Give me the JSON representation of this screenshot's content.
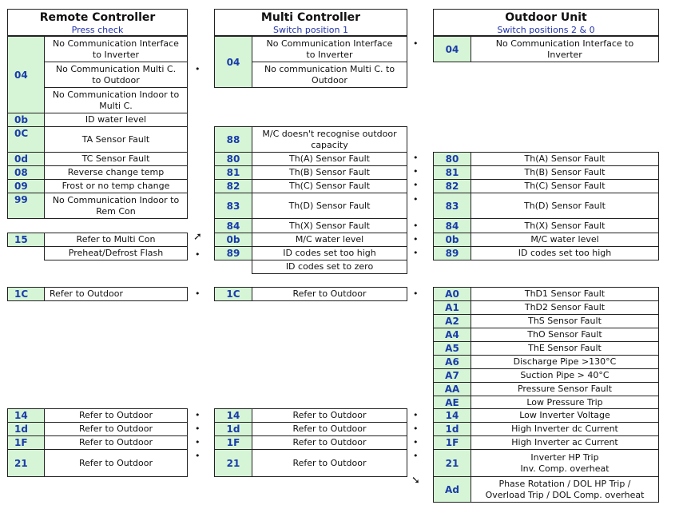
{
  "marks": {
    "bullet": "•",
    "arrow_up_right": "➚",
    "arrow_down_right": "➘"
  },
  "colors": {
    "code_bg": "#d6f5d6",
    "code_text": "#1a3caa",
    "subtitle": "#2233aa"
  },
  "left": {
    "title": "Remote Controller",
    "subtitle": "Press check",
    "rows": [
      {
        "code": "04",
        "desc": "No Communication Interface\nto Inverter"
      },
      {
        "code": "",
        "desc": "No Communication Multi C.\nto Outdoor"
      },
      {
        "code": "",
        "desc": "No Communication Indoor to\nMulti C."
      },
      {
        "code": "0b",
        "desc": "ID water level"
      },
      {
        "code": "0C",
        "desc": "TA Sensor Fault"
      },
      {
        "code": "0d",
        "desc": "TC Sensor Fault"
      },
      {
        "code": "08",
        "desc": "Reverse change temp"
      },
      {
        "code": "09",
        "desc": "Frost or no temp change"
      },
      {
        "code": "99",
        "desc": "No Communication Indoor to\nRem Con"
      },
      {
        "code": "15",
        "desc": "Refer to Multi Con"
      },
      {
        "code": "",
        "desc": "Preheat/Defrost Flash"
      },
      {
        "code": "1C",
        "desc": "Refer to Outdoor"
      },
      {
        "code": "14",
        "desc": "Refer to Outdoor"
      },
      {
        "code": "1d",
        "desc": "Refer to Outdoor"
      },
      {
        "code": "1F",
        "desc": "Refer to Outdoor"
      },
      {
        "code": "21",
        "desc": "Refer to Outdoor"
      }
    ]
  },
  "middle": {
    "title": "Multi Controller",
    "subtitle": "Switch position 1",
    "rows": [
      {
        "code": "04",
        "desc": "No Communication Interface\nto Inverter"
      },
      {
        "code": "",
        "desc": "No communication Multi C. to\nOutdoor"
      },
      {
        "code": "88",
        "desc": "M/C doesn't recognise outdoor\ncapacity"
      },
      {
        "code": "80",
        "desc": "Th(A) Sensor Fault"
      },
      {
        "code": "81",
        "desc": "Th(B) Sensor Fault"
      },
      {
        "code": "82",
        "desc": "Th(C) Sensor Fault"
      },
      {
        "code": "83",
        "desc": "Th(D) Sensor Fault"
      },
      {
        "code": "84",
        "desc": "Th(X) Sensor Fault"
      },
      {
        "code": "0b",
        "desc": "M/C water level"
      },
      {
        "code": "89",
        "desc": "ID codes set too high"
      },
      {
        "code": "",
        "desc": "ID codes set to zero"
      },
      {
        "code": "1C",
        "desc": "Refer to Outdoor"
      },
      {
        "code": "14",
        "desc": "Refer to Outdoor"
      },
      {
        "code": "1d",
        "desc": "Refer to Outdoor"
      },
      {
        "code": "1F",
        "desc": "Refer to Outdoor"
      },
      {
        "code": "21",
        "desc": "Refer to Outdoor"
      }
    ]
  },
  "right": {
    "title": "Outdoor Unit",
    "subtitle": "Switch positions 2 & 0",
    "rows": [
      {
        "code": "04",
        "desc": "No Communication Interface to\nInverter"
      },
      {
        "code": "80",
        "desc": "Th(A) Sensor Fault"
      },
      {
        "code": "81",
        "desc": "Th(B) Sensor Fault"
      },
      {
        "code": "82",
        "desc": "Th(C) Sensor Fault"
      },
      {
        "code": "83",
        "desc": "Th(D) Sensor Fault"
      },
      {
        "code": "84",
        "desc": "Th(X) Sensor Fault"
      },
      {
        "code": "0b",
        "desc": "M/C water level"
      },
      {
        "code": "89",
        "desc": "ID codes set too high"
      },
      {
        "code": "A0",
        "desc": "ThD1 Sensor Fault"
      },
      {
        "code": "A1",
        "desc": "ThD2 Sensor Fault"
      },
      {
        "code": "A2",
        "desc": "ThS  Sensor Fault"
      },
      {
        "code": "A4",
        "desc": "ThO Sensor Fault"
      },
      {
        "code": "A5",
        "desc": "ThE Sensor Fault"
      },
      {
        "code": "A6",
        "desc": "Discharge Pipe >130°C"
      },
      {
        "code": "A7",
        "desc": "Suction Pipe > 40°C"
      },
      {
        "code": "AA",
        "desc": "Pressure Sensor Fault"
      },
      {
        "code": "AE",
        "desc": "Low Pressure Trip"
      },
      {
        "code": "14",
        "desc": "Low Inverter Voltage"
      },
      {
        "code": "1d",
        "desc": "High Inverter dc Current"
      },
      {
        "code": "1F",
        "desc": "High Inverter ac Current"
      },
      {
        "code": "21",
        "desc": "Inverter HP Trip\nInv. Comp. overheat"
      },
      {
        "code": "Ad",
        "desc": "Phase Rotation / DOL HP Trip /\nOverload Trip / DOL Comp. overheat"
      }
    ]
  }
}
